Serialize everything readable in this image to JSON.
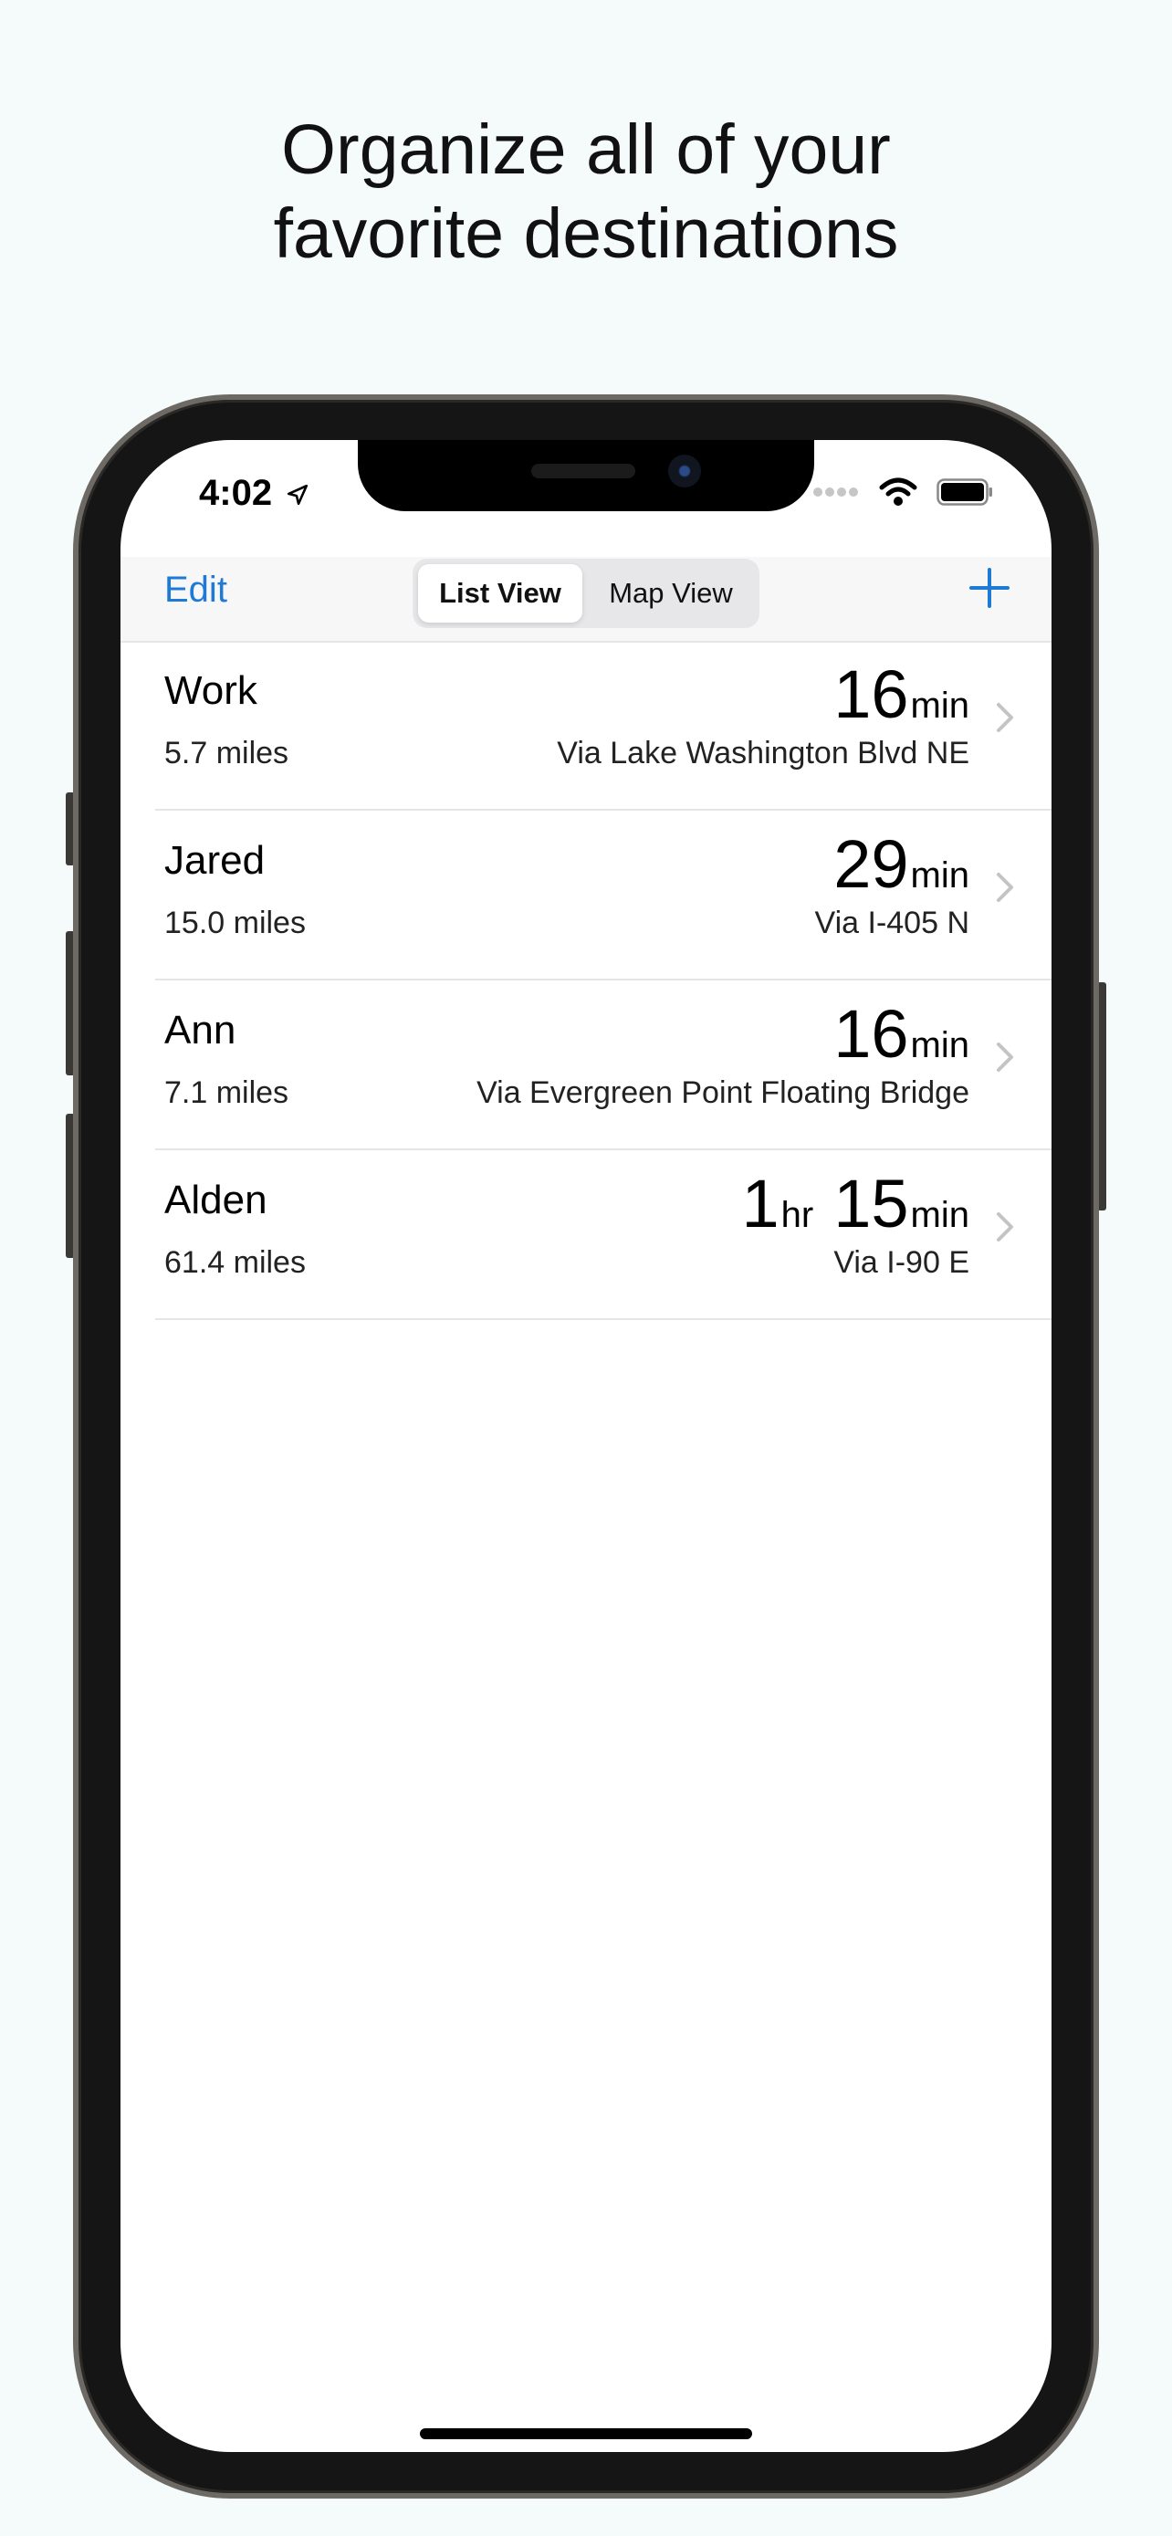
{
  "headline": {
    "line1": "Organize all of your",
    "line2": "favorite destinations"
  },
  "status_bar": {
    "time": "4:02"
  },
  "nav": {
    "edit_label": "Edit",
    "segments": [
      {
        "label": "List View",
        "active": true
      },
      {
        "label": "Map View",
        "active": false
      }
    ],
    "add_icon": "plus-icon"
  },
  "destinations": [
    {
      "name": "Work",
      "distance": "5.7 miles",
      "eta_hr": "",
      "eta_hr_unit": "",
      "eta_min": "16",
      "eta_min_unit": "min",
      "via": "Via Lake Washington Blvd NE"
    },
    {
      "name": "Jared",
      "distance": "15.0 miles",
      "eta_hr": "",
      "eta_hr_unit": "",
      "eta_min": "29",
      "eta_min_unit": "min",
      "via": "Via I-405 N"
    },
    {
      "name": "Ann",
      "distance": "7.1 miles",
      "eta_hr": "",
      "eta_hr_unit": "",
      "eta_min": "16",
      "eta_min_unit": "min",
      "via": "Via Evergreen Point Floating Bridge"
    },
    {
      "name": "Alden",
      "distance": "61.4 miles",
      "eta_hr": "1",
      "eta_hr_unit": "hr",
      "eta_min": "15",
      "eta_min_unit": "min",
      "via": "Via I-90 E"
    }
  ],
  "colors": {
    "accent": "#1f7ad6",
    "page_bg": "#f5fbfb",
    "frame": "#151515"
  }
}
